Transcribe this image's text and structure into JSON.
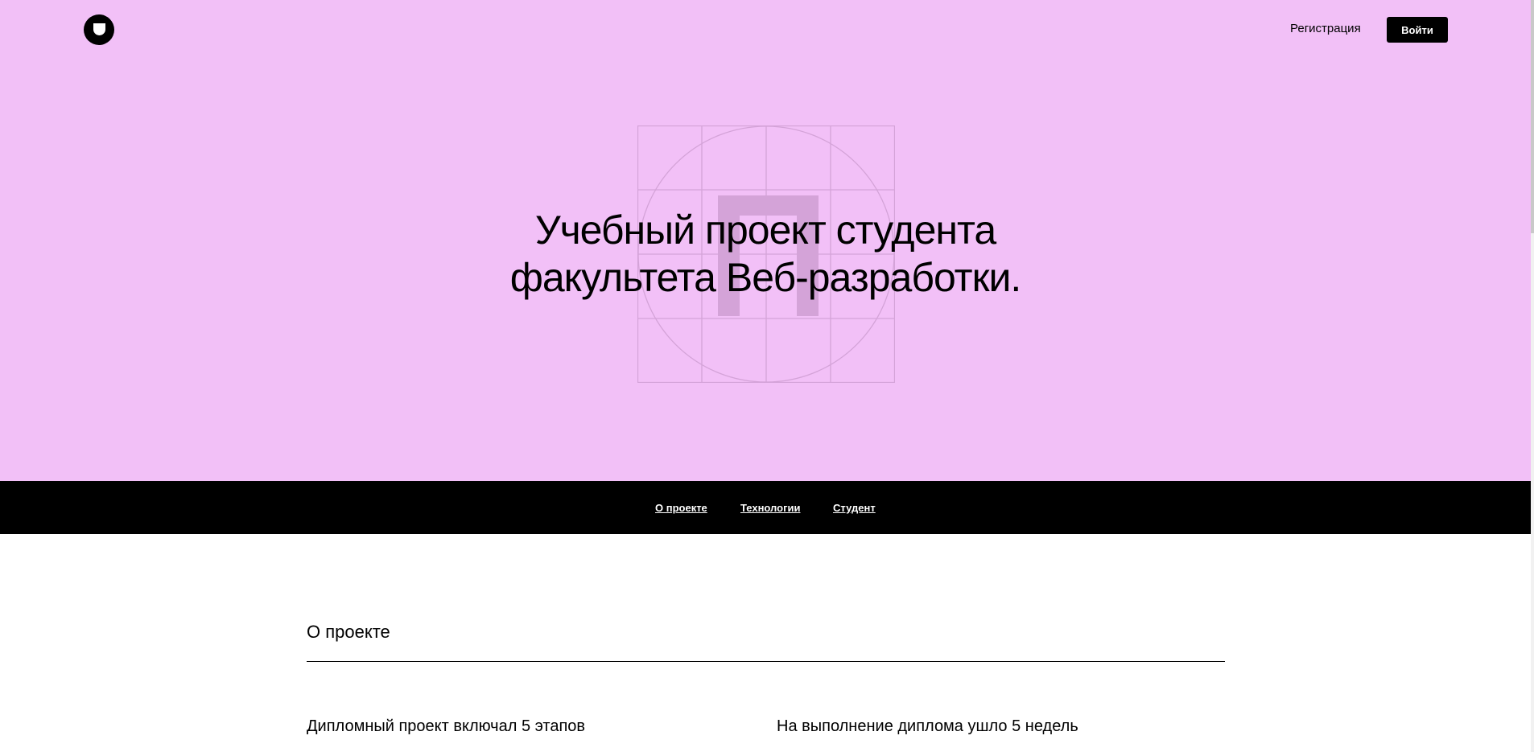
{
  "header": {
    "register_label": "Регистрация",
    "login_label": "Войти"
  },
  "hero": {
    "title": "Учебный проект студента факультета Веб-разработки.",
    "background_color": "#F2C0F7"
  },
  "anchor_nav": {
    "items": [
      {
        "label": "О проекте"
      },
      {
        "label": "Технологии"
      },
      {
        "label": "Студент"
      }
    ]
  },
  "about": {
    "title": "О проекте",
    "facts": [
      {
        "heading": "Дипломный проект включал 5 этапов"
      },
      {
        "heading": "На выполнение диплома ушло 5 недель"
      }
    ]
  }
}
